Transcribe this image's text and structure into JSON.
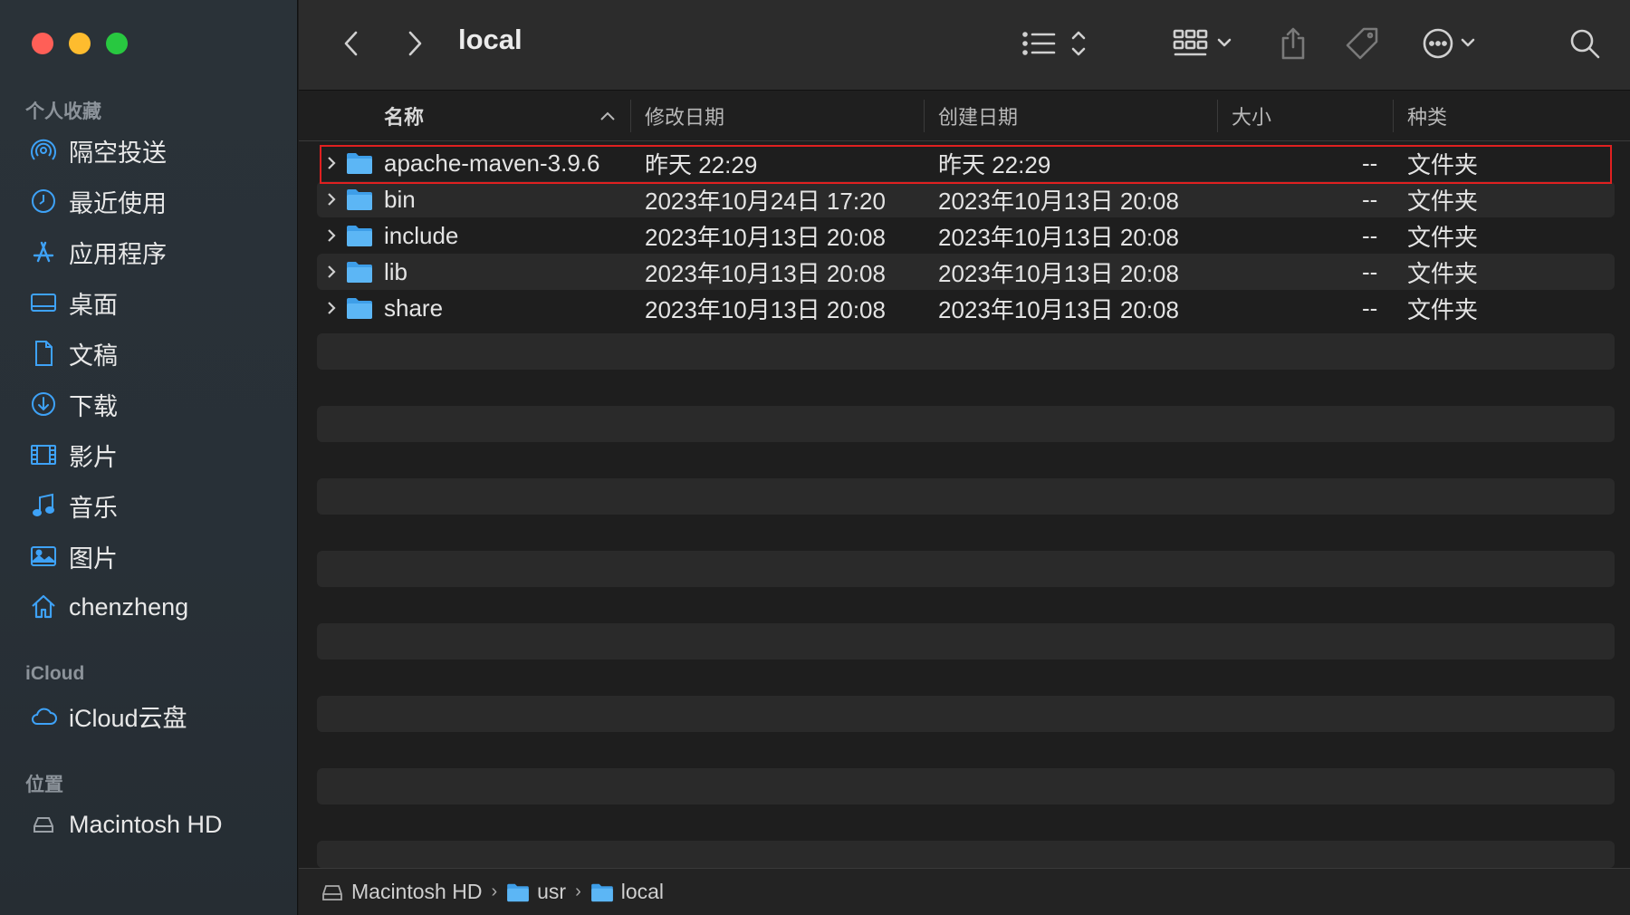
{
  "window": {
    "title": "local"
  },
  "sidebar": {
    "favorites_title": "个人收藏",
    "favorites": [
      {
        "label": "隔空投送",
        "icon": "airdrop-icon"
      },
      {
        "label": "最近使用",
        "icon": "clock-icon"
      },
      {
        "label": "应用程序",
        "icon": "applications-icon"
      },
      {
        "label": "桌面",
        "icon": "desktop-icon"
      },
      {
        "label": "文稿",
        "icon": "document-icon"
      },
      {
        "label": "下载",
        "icon": "download-icon"
      },
      {
        "label": "影片",
        "icon": "film-icon"
      },
      {
        "label": "音乐",
        "icon": "music-icon"
      },
      {
        "label": "图片",
        "icon": "photo-icon"
      },
      {
        "label": "chenzheng",
        "icon": "home-icon"
      }
    ],
    "icloud_title": "iCloud",
    "icloud": [
      {
        "label": "iCloud云盘",
        "icon": "cloud-icon"
      }
    ],
    "locations_title": "位置",
    "locations": [
      {
        "label": "Macintosh HD",
        "icon": "disk-icon"
      }
    ]
  },
  "columns": {
    "name": "名称",
    "modified": "修改日期",
    "created": "创建日期",
    "size": "大小",
    "kind": "种类"
  },
  "files": [
    {
      "name": "apache-maven-3.9.6",
      "modified": "昨天 22:29",
      "created": "昨天 22:29",
      "size": "--",
      "kind": "文件夹"
    },
    {
      "name": "bin",
      "modified": "2023年10月24日 17:20",
      "created": "2023年10月13日 20:08",
      "size": "--",
      "kind": "文件夹"
    },
    {
      "name": "include",
      "modified": "2023年10月13日 20:08",
      "created": "2023年10月13日 20:08",
      "size": "--",
      "kind": "文件夹"
    },
    {
      "name": "lib",
      "modified": "2023年10月13日 20:08",
      "created": "2023年10月13日 20:08",
      "size": "--",
      "kind": "文件夹"
    },
    {
      "name": "share",
      "modified": "2023年10月13日 20:08",
      "created": "2023年10月13日 20:08",
      "size": "--",
      "kind": "文件夹"
    }
  ],
  "pathbar": [
    "Macintosh HD",
    "usr",
    "local"
  ],
  "colors": {
    "accent": "#3ea2f7",
    "folder": "#5cb6f5",
    "highlight": "#e02020"
  }
}
